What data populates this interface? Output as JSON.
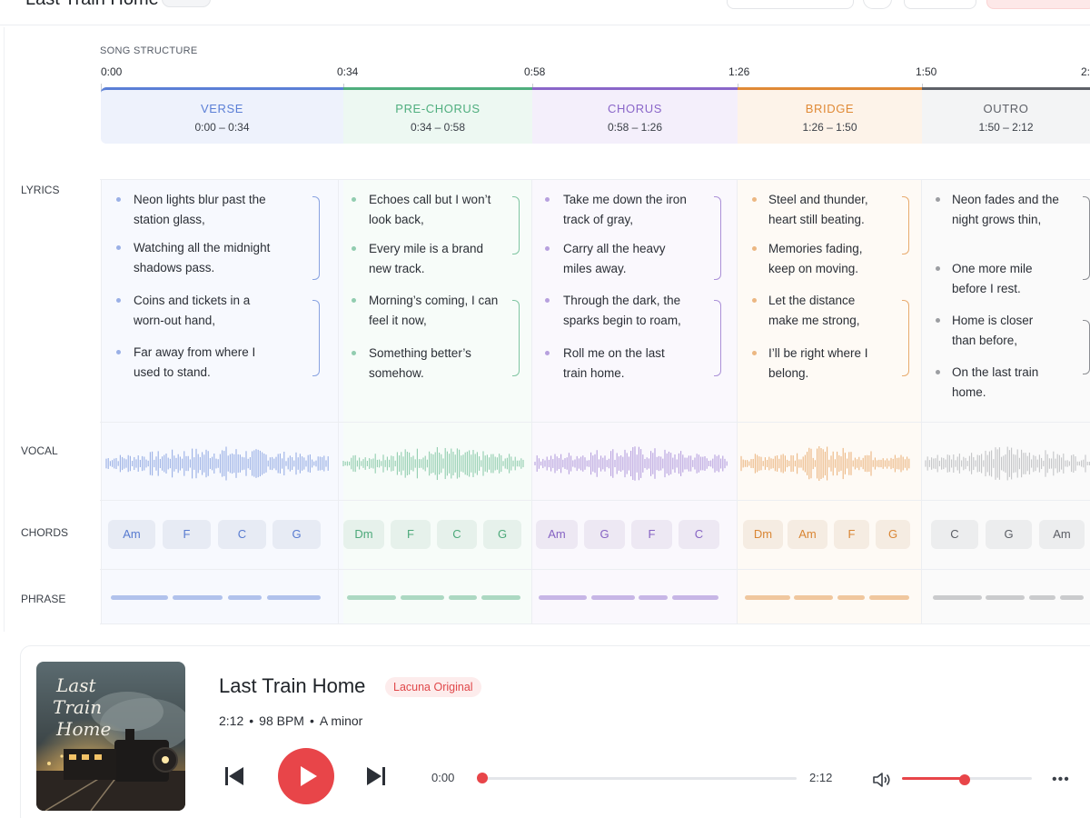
{
  "app": {
    "title": "Last Train Home"
  },
  "structure": {
    "label": "SONG STRUCTURE",
    "timecodes": [
      "0:00",
      "0:34",
      "0:58",
      "1:26",
      "1:50",
      "2:"
    ],
    "sections": [
      {
        "name": "VERSE",
        "range": "0:00 – 0:34",
        "color": "#5b7fd6",
        "bg": "#eef2fc"
      },
      {
        "name": "PRE-CHORUS",
        "range": "0:34 – 0:58",
        "color": "#4fae7e",
        "bg": "#edf8f2"
      },
      {
        "name": "CHORUS",
        "range": "0:58 – 1:26",
        "color": "#8a66c9",
        "bg": "#f4effb"
      },
      {
        "name": "BRIDGE",
        "range": "1:26 – 1:50",
        "color": "#e08a36",
        "bg": "#fdf3e9"
      },
      {
        "name": "OUTRO",
        "range": "1:50 – 2:12",
        "color": "#5e6168",
        "bg": "#f3f4f5"
      }
    ]
  },
  "rows": {
    "lyrics": "LYRICS",
    "vocal": "VOCAL",
    "chords": "CHORDS",
    "phrase": "PHRASE"
  },
  "lyrics": [
    [
      "Neon lights blur past the station glass,",
      "Watching all the midnight shadows pass.",
      "Coins and tickets in a worn-out hand,",
      "Far away from where I used to stand."
    ],
    [
      "Echoes call but I won’t look back,",
      "Every mile is a brand new track.",
      "Morning’s coming, I can feel it now,",
      "Something better’s somehow."
    ],
    [
      "Take me down the iron track of gray,",
      "Carry all the heavy miles away.",
      "Through the dark, the sparks begin to roam,",
      "Roll me on the last train home."
    ],
    [
      "Steel and thunder, heart still beating.",
      "Memories fading, keep on moving.",
      "Let the distance make me strong,",
      "I’ll be right where I belong."
    ],
    [
      "Neon fades and the night grows thin,",
      "One more mile before I rest.",
      "Home is closer than before,",
      "On the last train home."
    ]
  ],
  "chords": [
    [
      "Am",
      "F",
      "C",
      "G"
    ],
    [
      "Dm",
      "F",
      "C",
      "G"
    ],
    [
      "Am",
      "G",
      "F",
      "C"
    ],
    [
      "Dm",
      "Am",
      "F",
      "G"
    ],
    [
      "C",
      "G",
      "Am"
    ]
  ],
  "player": {
    "title": "Last Train Home",
    "badge": "Lacuna Original",
    "duration": "2:12",
    "bpm": "98 BPM",
    "key": "A minor",
    "separator": "•",
    "elapsed": "0:00",
    "total": "2:12",
    "progress": 0.0,
    "volume": 0.48,
    "cover_text": [
      "Last",
      "Train",
      "Home"
    ],
    "accent": "#e84549"
  }
}
